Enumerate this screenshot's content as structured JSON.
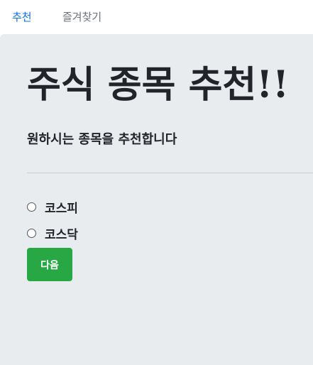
{
  "nav": {
    "items": [
      {
        "label": "추천",
        "active": true
      },
      {
        "label": "즐겨찾기",
        "active": false
      }
    ]
  },
  "main": {
    "title": "주식 종목 추천!!",
    "subtitle": "원하시는 종목을 추천합니다",
    "options": [
      {
        "label": "코스피",
        "checked": false
      },
      {
        "label": "코스닥",
        "checked": false
      }
    ],
    "next_button_label": "다음"
  },
  "colors": {
    "accent": "#0d6efd",
    "nav_inactive": "#6c757d",
    "background": "#e9ecef",
    "button": "#28a745"
  }
}
